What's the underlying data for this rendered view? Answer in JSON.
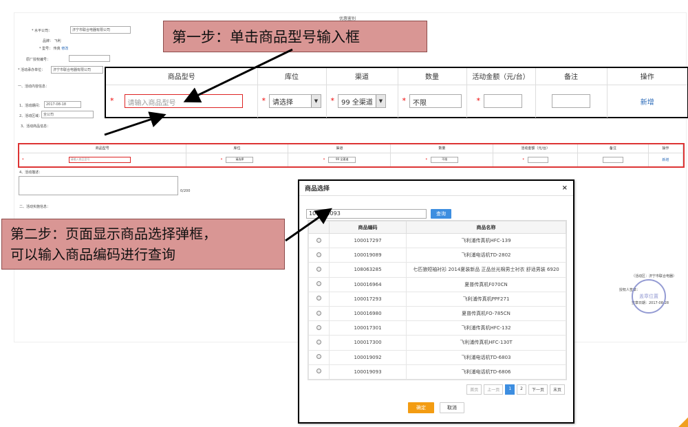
{
  "background_form": {
    "title": "优惠鉴别",
    "lines": [
      {
        "text": "* 水平公司：",
        "value": "济宁市联合电器有限公司"
      },
      {
        "text": "品牌： 飞利"
      },
      {
        "text": "* 型号： 传真",
        "link": "修改"
      },
      {
        "text": "原厂授权编号："
      },
      {
        "text": "* 活动承办单位：",
        "value": "济宁市联合电器有限公司"
      },
      {
        "text": "一、活动内容信息："
      },
      {
        "text": "1、活动期间：",
        "value": "2017-08-18"
      },
      {
        "text": "2、活动区域：",
        "value": "全公司"
      },
      {
        "text": "3、活动商品信息："
      },
      {
        "text": "4、活动描述："
      },
      {
        "text": "二、活动实施信息："
      }
    ],
    "side_text": [
      "（活动区：济宁市联合电器）",
      "授权人签章：",
      "签章日期：2017-08-28"
    ],
    "counter": "0/200",
    "stamp": "盖章位置"
  },
  "callouts": {
    "step1": "第一步：单击商品型号输入框",
    "step2_line1": "第二步：页面显示商品选择弹框，",
    "step2_line2": "可以输入商品编码进行查询"
  },
  "big_table": {
    "headers": [
      "商品型号",
      "库位",
      "渠道",
      "数量",
      "活动金额（元/台）",
      "备注",
      "操作"
    ],
    "model_placeholder": "请输入商品型号",
    "location_value": "请选择",
    "channel_value": "99 全渠道",
    "quantity_value": "不限",
    "action_label": "新增",
    "required_mark": "*"
  },
  "small_table": {
    "headers": [
      "商品型号",
      "库位",
      "渠道",
      "数量",
      "活动金额（元/台）",
      "备注",
      "操作"
    ],
    "model_placeholder": "请输入商品型号",
    "location_value": "请选择",
    "channel_value": "99 全渠道",
    "quantity_value": "不限",
    "action_label": "新增"
  },
  "modal": {
    "title": "商品选择",
    "close": "×",
    "search_value": "100019093",
    "search_button": "查询",
    "col_code": "商品编码",
    "col_name": "商品名称",
    "rows": [
      {
        "code": "100017297",
        "name": "飞利浦传真机HFC-139"
      },
      {
        "code": "100019089",
        "name": "飞利浦电话机TD-2802"
      },
      {
        "code": "108063285",
        "name": "七匹狼短袖衬衫 2014夏装新品 正品丝光棉男士衬衣 舒适男装 6920"
      },
      {
        "code": "100016964",
        "name": "夏普传真机F070CN"
      },
      {
        "code": "100017293",
        "name": "飞利浦传真机PPF271"
      },
      {
        "code": "100016980",
        "name": "夏普传真机FO-785CN"
      },
      {
        "code": "100017301",
        "name": "飞利浦传真机HFC-132"
      },
      {
        "code": "100017300",
        "name": "飞利浦传真机HFC-130T"
      },
      {
        "code": "100019092",
        "name": "飞利浦电话机TD-6803"
      },
      {
        "code": "100019093",
        "name": "飞利浦电话机TD-6806"
      }
    ],
    "pager": {
      "first": "首页",
      "prev": "上一页",
      "p1": "1",
      "p2": "2",
      "next": "下一页",
      "last": "末页"
    },
    "ok": "确定",
    "cancel": "取消"
  },
  "colors": {
    "callout": "#d99694",
    "accent": "#3d8ee0",
    "confirm": "#f39c12",
    "required": "#e00000"
  }
}
